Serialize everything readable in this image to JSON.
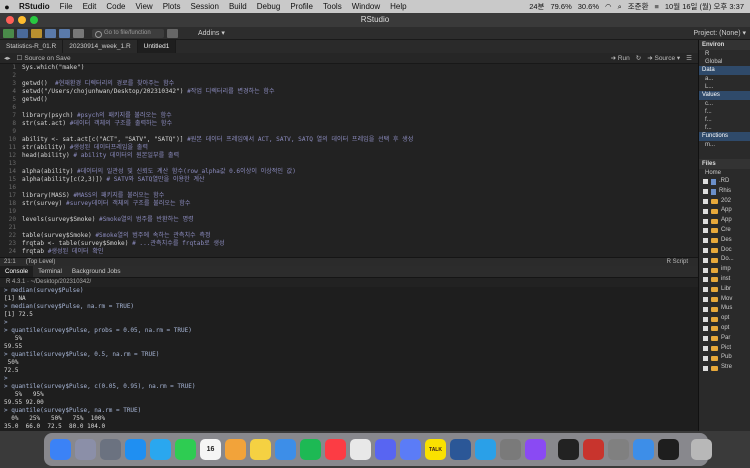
{
  "menubar": {
    "app": "RStudio",
    "items": [
      "File",
      "Edit",
      "Code",
      "View",
      "Plots",
      "Session",
      "Build",
      "Debug",
      "Profile",
      "Tools",
      "Window",
      "Help"
    ],
    "status": [
      "24분",
      "79.6%",
      "30.6%",
      "조준환",
      "10월 16일 (월) 오후 3:37"
    ]
  },
  "window": {
    "title": "RStudio"
  },
  "toolbar": {
    "goto_placeholder": "Go to file/function",
    "addins": "Addins",
    "project": "Project: (None)"
  },
  "editor": {
    "tabs": [
      "Statistics-R_01.R",
      "20230914_week_1.R",
      "Untitled1"
    ],
    "source_on_save": "Source on Save",
    "run": "Run",
    "source": "Source",
    "status_pos": "21:1",
    "status_scope": "(Top Level)",
    "status_lang": "R Script",
    "lines": [
      {
        "n": "1",
        "code": "Sys.which(\"make\")",
        "comment": ""
      },
      {
        "n": "2",
        "code": "",
        "comment": ""
      },
      {
        "n": "3",
        "code": "getwd()  ",
        "comment": "#현재환경 디렉터리의 경로를 찾아주는 함수"
      },
      {
        "n": "4",
        "code": "setwd(\"/Users/chojunhwan/Desktop/202310342\") ",
        "comment": "#작업 디렉터리를 변경하는 함수"
      },
      {
        "n": "5",
        "code": "getwd()",
        "comment": ""
      },
      {
        "n": "6",
        "code": "",
        "comment": ""
      },
      {
        "n": "7",
        "code": "library(psych) ",
        "comment": "#psych의 패키지를 불러오는 함수"
      },
      {
        "n": "8",
        "code": "str(sat.act) ",
        "comment": "#데이터 객체의 구조를 출력하는 함수"
      },
      {
        "n": "9",
        "code": "",
        "comment": ""
      },
      {
        "n": "10",
        "code": "ability <- sat.act[c(\"ACT\", \"SATV\", \"SATQ\")] ",
        "comment": "#원본 데이터 프레임에서 ACT, SATV, SATQ 열의 데이터 프레임을 선택 후 생성"
      },
      {
        "n": "11",
        "code": "str(ability) ",
        "comment": "#생성된 데이터프레임을 출력"
      },
      {
        "n": "12",
        "code": "head(ability) ",
        "comment": "# ability 데이터의 원본일부를 출력"
      },
      {
        "n": "13",
        "code": "",
        "comment": ""
      },
      {
        "n": "14",
        "code": "alpha(ability) ",
        "comment": "#데이터의 일관성 및 신뢰도 계산 함수(row_alpha값 0.6이상이 이상적인 값)"
      },
      {
        "n": "15",
        "code": "alpha(ability[c(2,3)]) ",
        "comment": "# SATV와 SATQ열만을 이용한 계산"
      },
      {
        "n": "16",
        "code": "",
        "comment": ""
      },
      {
        "n": "17",
        "code": "library(MASS) ",
        "comment": "#MASS의 패키지를 불러오는 함수"
      },
      {
        "n": "18",
        "code": "str(survey) ",
        "comment": "#survey데이터 객체의 구조를 불러오는 함수"
      },
      {
        "n": "19",
        "code": "",
        "comment": ""
      },
      {
        "n": "20",
        "code": "levels(survey$Smoke) ",
        "comment": "#Smoke열의 범주를 반환하는 명령"
      },
      {
        "n": "21",
        "code": "",
        "comment": ""
      },
      {
        "n": "22",
        "code": "table(survey$Smoke) ",
        "comment": "#Smoke열의 범주에 속하는 관측치수 측정"
      },
      {
        "n": "23",
        "code": "frqtab <- table(survey$Smoke) ",
        "comment": "# ...관측치수를 frqtab로 생성"
      },
      {
        "n": "24",
        "code": "frqtab ",
        "comment": "#생성된 데이터 확인"
      }
    ]
  },
  "console": {
    "tabs": [
      "Console",
      "Terminal",
      "Background Jobs"
    ],
    "path": "R 4.3.1 · ~/Desktop/202310342/",
    "lines": [
      {
        "t": "in",
        "s": "> median(survey$Pulse)"
      },
      {
        "t": "out",
        "s": "[1] NA"
      },
      {
        "t": "in",
        "s": "> median(survey$Pulse, na.rm = TRUE)"
      },
      {
        "t": "out",
        "s": "[1] 72.5"
      },
      {
        "t": "in",
        "s": ">"
      },
      {
        "t": "in",
        "s": "> quantile(survey$Pulse, probs = 0.05, na.rm = TRUE)"
      },
      {
        "t": "out",
        "s": "   5%"
      },
      {
        "t": "out",
        "s": "59.55"
      },
      {
        "t": "in",
        "s": "> quantile(survey$Pulse, 0.5, na.rm = TRUE)"
      },
      {
        "t": "out",
        "s": " 50%"
      },
      {
        "t": "out",
        "s": "72.5"
      },
      {
        "t": "in",
        "s": ">"
      },
      {
        "t": "in",
        "s": "> quantile(survey$Pulse, c(0.05, 0.95), na.rm = TRUE)"
      },
      {
        "t": "out",
        "s": "   5%   95%"
      },
      {
        "t": "out",
        "s": "59.55 92.00"
      },
      {
        "t": "in",
        "s": "> quantile(survey$Pulse, na.rm = TRUE)"
      },
      {
        "t": "out",
        "s": "  0%   25%   50%   75%  100%"
      },
      {
        "t": "out",
        "s": "35.0  66.0  72.5  80.0 104.0"
      }
    ]
  },
  "right_pane": {
    "env_tab": "Environ",
    "r_label": "R",
    "global": "Global",
    "data_head": "Data",
    "data_items": [
      "a...",
      "L..."
    ],
    "values_head": "Values",
    "value_items": [
      "c...",
      "f...",
      "f...",
      "f..."
    ],
    "functions_head": "Functions",
    "function_items": [
      "m..."
    ],
    "files_tab": "Files",
    "home": "Home",
    "file_items": [
      ".RD",
      "Rhis",
      "202",
      "App",
      "App",
      "Cre",
      "Des",
      "Doc",
      "Do...",
      "imp",
      "inst",
      "Libr",
      "Mov",
      "Mus",
      "opt",
      "opt",
      "Par",
      "Pict",
      "Pub",
      "Stre"
    ]
  },
  "dock": {
    "apps": [
      {
        "name": "Finder",
        "color": "#3b82f6"
      },
      {
        "name": "Launchpad",
        "color": "#8b8fa8"
      },
      {
        "name": "Apps",
        "color": "#6b7280"
      },
      {
        "name": "App Store",
        "color": "#1f8ff2"
      },
      {
        "name": "Safari",
        "color": "#2aa7ef"
      },
      {
        "name": "Messages",
        "color": "#2ecc52"
      },
      {
        "name": "Calendar",
        "color": "#f5f5f5"
      },
      {
        "name": "Photos",
        "color": "#f2a33a"
      },
      {
        "name": "Notes",
        "color": "#f5d142"
      },
      {
        "name": "Mail",
        "color": "#3d8ee8"
      },
      {
        "name": "Spotify",
        "color": "#1db954"
      },
      {
        "name": "Music",
        "color": "#fc3c44"
      },
      {
        "name": "Chrome",
        "color": "#e8e8e8"
      },
      {
        "name": "Discord",
        "color": "#5865f2"
      },
      {
        "name": "Messenger",
        "color": "#5b7cf7"
      },
      {
        "name": "KakaoTalk",
        "color": "#fae100"
      },
      {
        "name": "Word",
        "color": "#2b5797"
      },
      {
        "name": "VS Code",
        "color": "#2aa0e8"
      },
      {
        "name": "Settings",
        "color": "#7a7a7a"
      },
      {
        "name": "GitHub",
        "color": "#8a4af3"
      },
      {
        "name": "Terminal",
        "color": "#222222"
      },
      {
        "name": "RStudio",
        "color": "#c8342d"
      },
      {
        "name": "System",
        "color": "#808080"
      },
      {
        "name": "Preview",
        "color": "#3d8ee8"
      },
      {
        "name": "Window",
        "color": "#1e1e1e"
      },
      {
        "name": "Trash",
        "color": "#b8b8b8"
      }
    ],
    "calendar_day": "16",
    "talk_label": "TALK"
  }
}
